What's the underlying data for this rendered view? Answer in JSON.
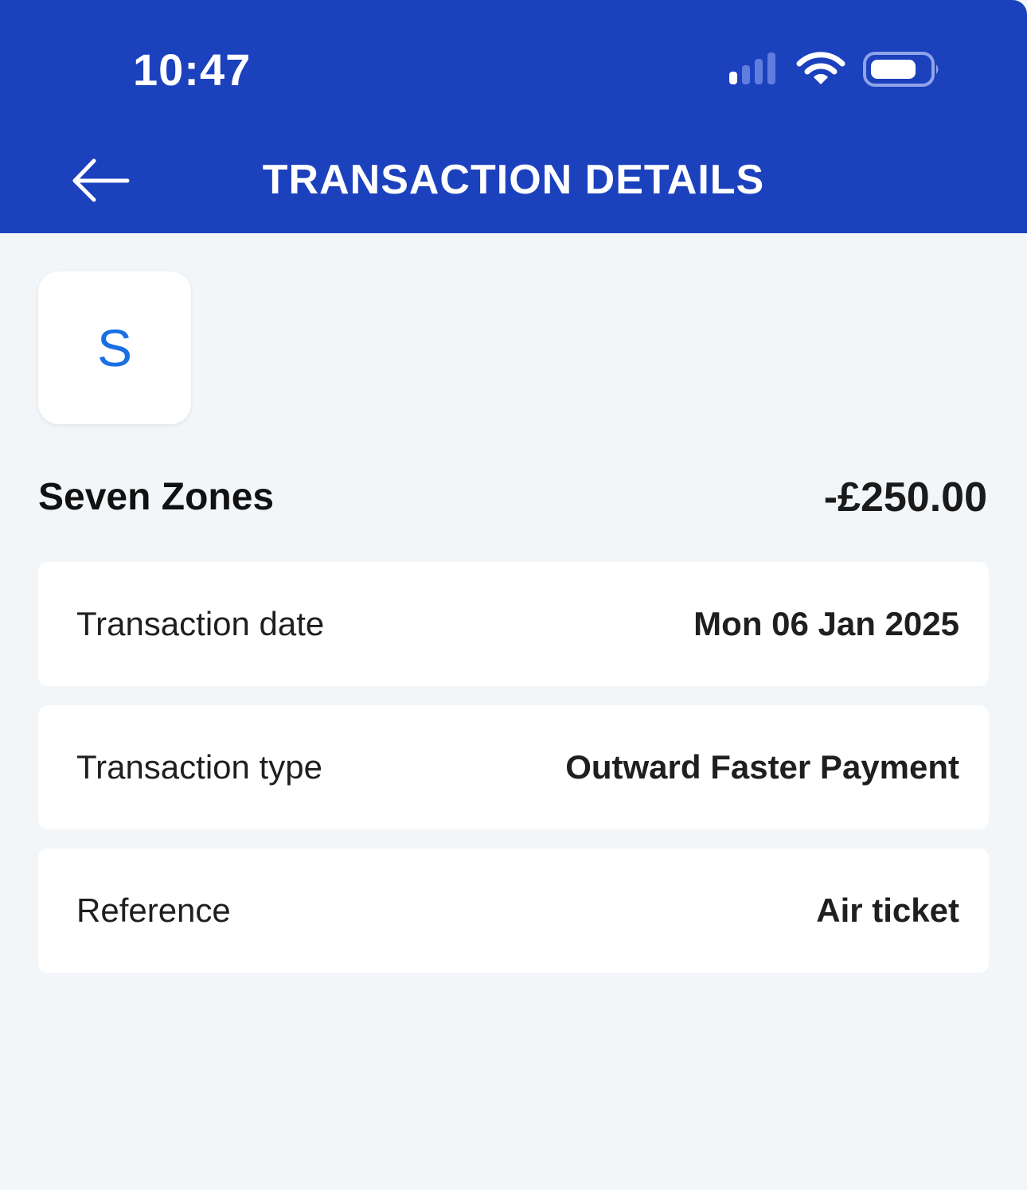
{
  "status_bar": {
    "time": "10:47",
    "icons": [
      "cellular-signal-icon",
      "wifi-icon",
      "battery-icon"
    ]
  },
  "header": {
    "title": "TRANSACTION DETAILS",
    "back_icon": "arrow-left-icon"
  },
  "transaction": {
    "avatar_letter": "S",
    "payee": "Seven Zones",
    "amount": "-£250.00",
    "details": [
      {
        "label": "Transaction date",
        "value": "Mon 06 Jan 2025"
      },
      {
        "label": "Transaction type",
        "value": "Outward Faster Payment"
      },
      {
        "label": "Reference",
        "value": "Air ticket"
      }
    ]
  },
  "colors": {
    "header_bg": "#1c41bd",
    "page_bg": "#f3f6f9",
    "avatar_letter": "#1a6fe3"
  }
}
